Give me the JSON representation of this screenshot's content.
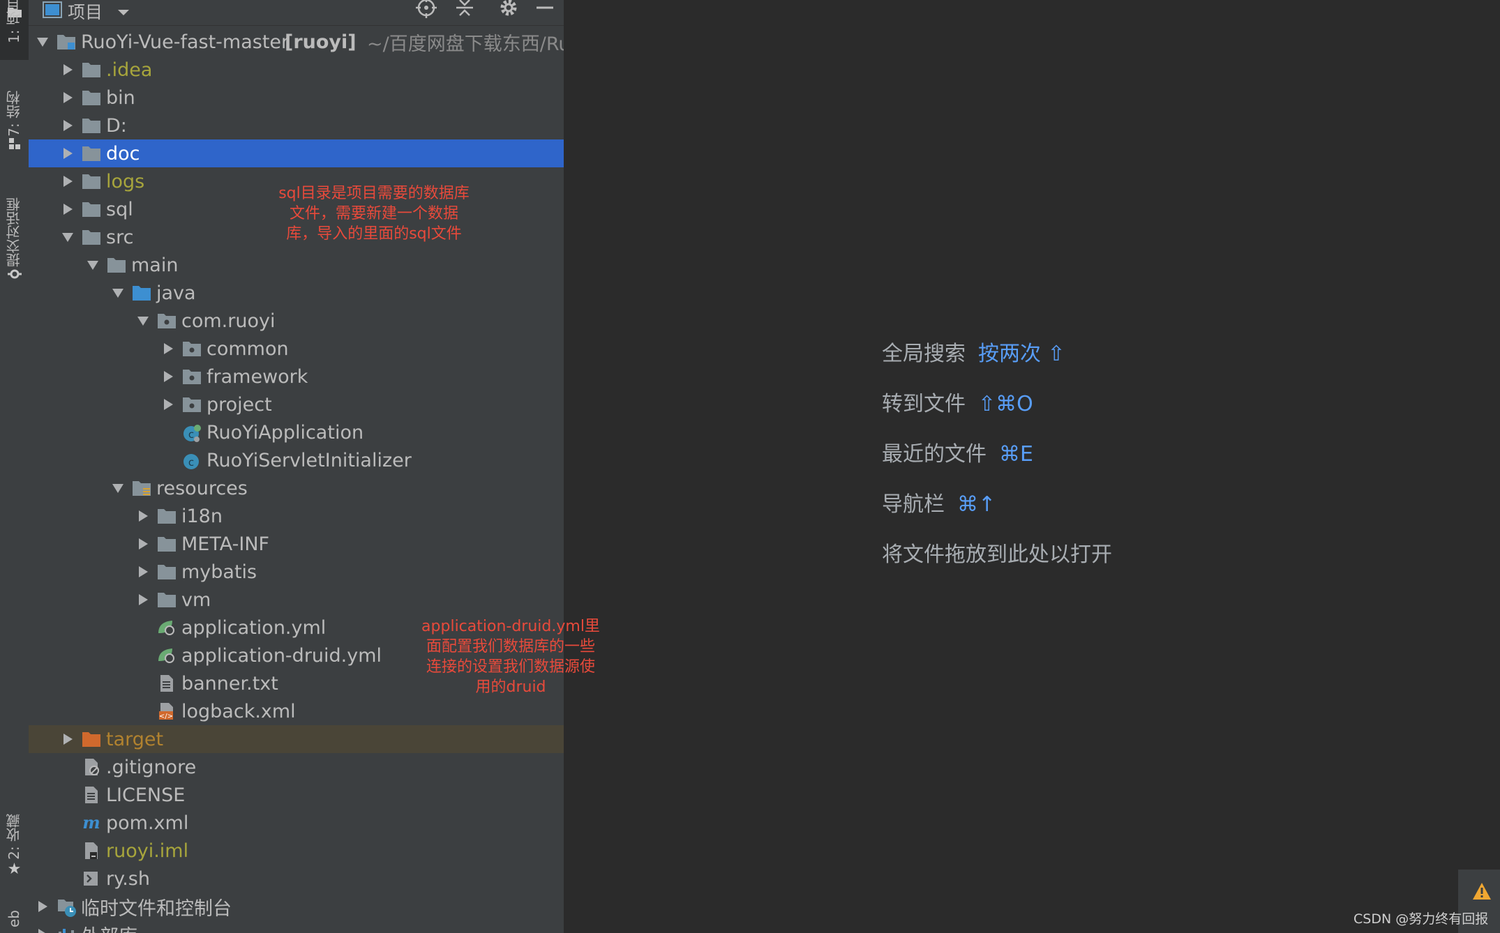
{
  "side_strip": {
    "project_tab": "1: 项目",
    "structure_tab": "7: 结构",
    "commit_tab": "提交对话框",
    "favorites_tab": "2: 收藏",
    "web_tab": "eb"
  },
  "panel": {
    "title": "项目"
  },
  "tree": [
    {
      "label": "RuoYi-Vue-fast-master",
      "bold": "[ruoyi]",
      "path": "~/百度网盘下载东西/RuoY",
      "icon": "module-folder-icon",
      "expand": "down",
      "level": 0
    },
    {
      "label": ".idea",
      "icon": "folder-icon",
      "expand": "right",
      "level": 1,
      "color": "yellow"
    },
    {
      "label": "bin",
      "icon": "folder-icon",
      "expand": "right",
      "level": 1
    },
    {
      "label": "D:",
      "icon": "folder-icon",
      "expand": "right",
      "level": 1
    },
    {
      "label": "doc",
      "icon": "folder-icon",
      "expand": "right",
      "level": 1,
      "selected": true
    },
    {
      "label": "logs",
      "icon": "folder-icon",
      "expand": "right",
      "level": 1,
      "color": "yellow"
    },
    {
      "label": "sql",
      "icon": "folder-icon",
      "expand": "right",
      "level": 1
    },
    {
      "label": "src",
      "icon": "folder-icon",
      "expand": "down",
      "level": 1
    },
    {
      "label": "main",
      "icon": "folder-icon",
      "expand": "down",
      "level": 2
    },
    {
      "label": "java",
      "icon": "source-folder-icon",
      "expand": "down",
      "level": 3
    },
    {
      "label": "com.ruoyi",
      "icon": "package-icon",
      "expand": "down",
      "level": 4
    },
    {
      "label": "common",
      "icon": "package-icon",
      "expand": "right",
      "level": 5
    },
    {
      "label": "framework",
      "icon": "package-icon",
      "expand": "right",
      "level": 5
    },
    {
      "label": "project",
      "icon": "package-icon",
      "expand": "right",
      "level": 5
    },
    {
      "label": "RuoYiApplication",
      "icon": "spring-boot-class-icon",
      "expand": "",
      "level": 5
    },
    {
      "label": "RuoYiServletInitializer",
      "icon": "class-icon",
      "expand": "",
      "level": 5
    },
    {
      "label": "resources",
      "icon": "resources-folder-icon",
      "expand": "down",
      "level": 3
    },
    {
      "label": "i18n",
      "icon": "folder-icon",
      "expand": "right",
      "level": 4
    },
    {
      "label": "META-INF",
      "icon": "folder-icon",
      "expand": "right",
      "level": 4
    },
    {
      "label": "mybatis",
      "icon": "folder-icon",
      "expand": "right",
      "level": 4
    },
    {
      "label": "vm",
      "icon": "folder-icon",
      "expand": "right",
      "level": 4
    },
    {
      "label": "application.yml",
      "icon": "yaml-config-icon",
      "expand": "",
      "level": 4
    },
    {
      "label": "application-druid.yml",
      "icon": "yaml-config-icon",
      "expand": "",
      "level": 4
    },
    {
      "label": "banner.txt",
      "icon": "text-file-icon",
      "expand": "",
      "level": 4
    },
    {
      "label": "logback.xml",
      "icon": "xml-file-icon",
      "expand": "",
      "level": 4
    },
    {
      "label": "target",
      "icon": "excluded-folder-icon",
      "expand": "right",
      "level": 1,
      "color": "orange",
      "excluded": true
    },
    {
      "label": ".gitignore",
      "icon": "ignore-file-icon",
      "expand": "",
      "level": 1
    },
    {
      "label": "LICENSE",
      "icon": "text-file-icon",
      "expand": "",
      "level": 1
    },
    {
      "label": "pom.xml",
      "icon": "maven-icon",
      "expand": "",
      "level": 1
    },
    {
      "label": "ruoyi.iml",
      "icon": "iml-file-icon",
      "expand": "",
      "level": 1,
      "color": "yellow"
    },
    {
      "label": "ry.sh",
      "icon": "shell-script-icon",
      "expand": "",
      "level": 1
    },
    {
      "label": "临时文件和控制台",
      "icon": "scratches-icon",
      "expand": "right",
      "level": 0
    },
    {
      "label": "外部库",
      "icon": "external-libraries-icon",
      "expand": "right",
      "level": 0
    }
  ],
  "annotations": {
    "sql_note": [
      "sql目录是项目需要的数据库",
      "文件，需要新建一个数据",
      "库，导入的里面的sql文件"
    ],
    "druid_note": [
      "application-druid.yml里",
      "面配置我们数据库的一些",
      "连接的设置我们数据源使",
      "用的druid"
    ]
  },
  "editor_hints": [
    {
      "text": "全局搜索",
      "key": "按两次 ⇧"
    },
    {
      "text": "转到文件",
      "key": "⇧⌘O"
    },
    {
      "text": "最近的文件",
      "key": "⌘E"
    },
    {
      "text": "导航栏",
      "key": "⌘↑"
    },
    {
      "text": "将文件拖放到此处以打开",
      "key": ""
    }
  ],
  "watermark": "CSDN @努力终有回报",
  "colors": {
    "selection": "#2f65ca",
    "folder": "#87939a",
    "source_folder": "#3d8fd1",
    "shortcut": "#589df6",
    "annotation": "#e84a3b"
  }
}
